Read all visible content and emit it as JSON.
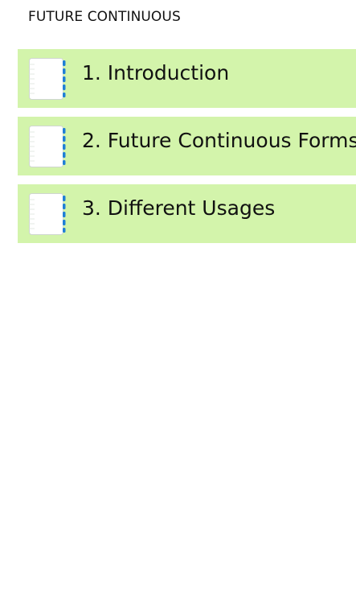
{
  "header": {
    "title": "FUTURE CONTINUOUS"
  },
  "lessons": [
    {
      "label": "1. Introduction",
      "icon": "notebook-icon"
    },
    {
      "label": "2. Future Continuous Forms",
      "icon": "notebook-icon"
    },
    {
      "label": "3. Different Usages",
      "icon": "notebook-icon"
    }
  ],
  "colors": {
    "background": "#ffffff",
    "item_background": "#d3f4ab",
    "notebook_binding": "#1f7fd6",
    "text": "#111111"
  }
}
